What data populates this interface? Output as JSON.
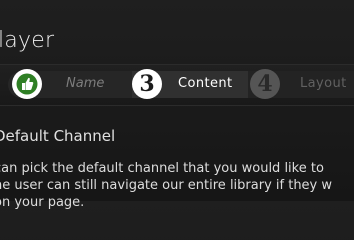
{
  "header": {
    "title": "layer"
  },
  "steps": [
    {
      "icon": "thumbs-up-icon",
      "label": "Name",
      "state": "done"
    },
    {
      "number": "3",
      "label": "Content",
      "state": "active"
    },
    {
      "number": "4",
      "label": "Layout",
      "state": "upcoming"
    }
  ],
  "section": {
    "heading": "Default Channel",
    "lines": [
      "can pick the default channel that you would like to",
      "he user can still navigate our entire library if they w",
      "on your page."
    ]
  },
  "colors": {
    "background": "#1a1a1a",
    "thumb_green": "#3a8f2a",
    "active_circle": "#ffffff",
    "upcoming_circle": "#555555"
  }
}
